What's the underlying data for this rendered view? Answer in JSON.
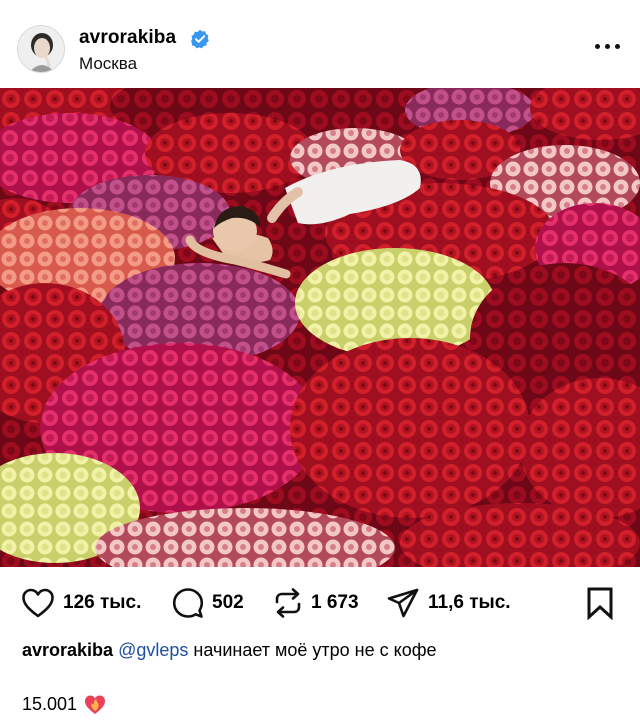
{
  "post": {
    "username": "avrorakiba",
    "location": "Москва",
    "media_description": "Photo: woman in white lying across bouquets of roses",
    "likes": "126 тыс.",
    "comments": "502",
    "reposts": "1 673",
    "shares": "11,6 тыс.",
    "caption_user": "avrorakiba",
    "caption_mention": "@gvleps",
    "caption_text": "начинает моё утро не с кофе",
    "date": "15.001"
  },
  "icons": {
    "verified": "verified-badge-icon",
    "more": "more-options-icon",
    "like": "heart-icon",
    "comment": "comment-icon",
    "repost": "repost-icon",
    "share": "paper-plane-icon",
    "bookmark": "bookmark-icon",
    "mute": "muted-speaker-icon",
    "emoji": "heart-fire-emoji"
  },
  "colors": {
    "verified_blue": "#3897f0",
    "mention_blue": "#1e4f9c"
  }
}
